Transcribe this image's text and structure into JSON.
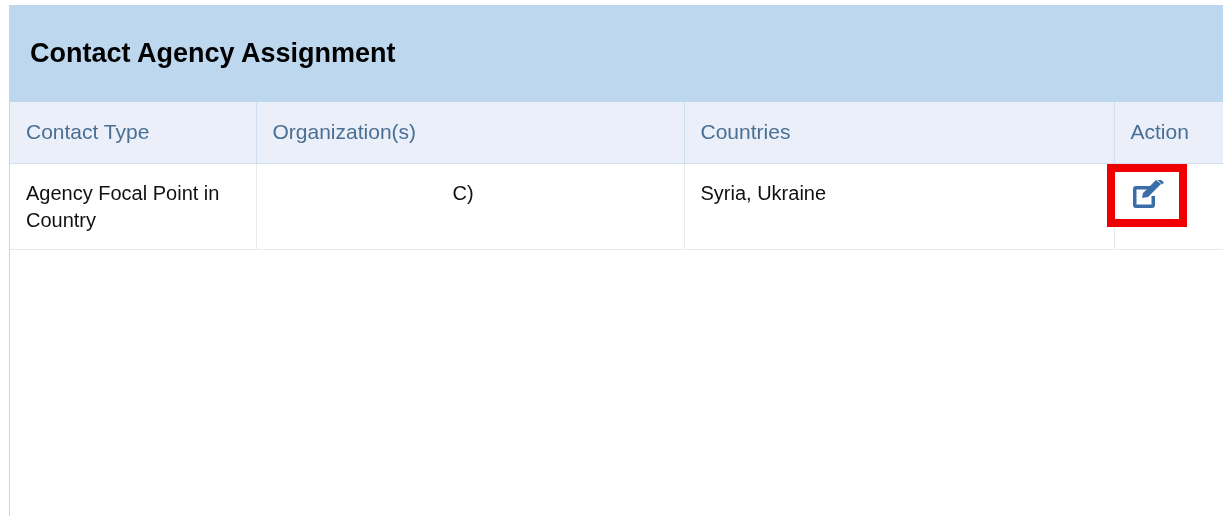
{
  "panel": {
    "title": "Contact Agency Assignment"
  },
  "table": {
    "columns": [
      "Contact Type",
      "Organization(s)",
      "Countries",
      "Action"
    ],
    "rows": [
      {
        "contact_type": "Agency Focal Point in Country",
        "organizations": "C)",
        "countries": "Syria, Ukraine",
        "edit_highlighted": true
      }
    ]
  }
}
